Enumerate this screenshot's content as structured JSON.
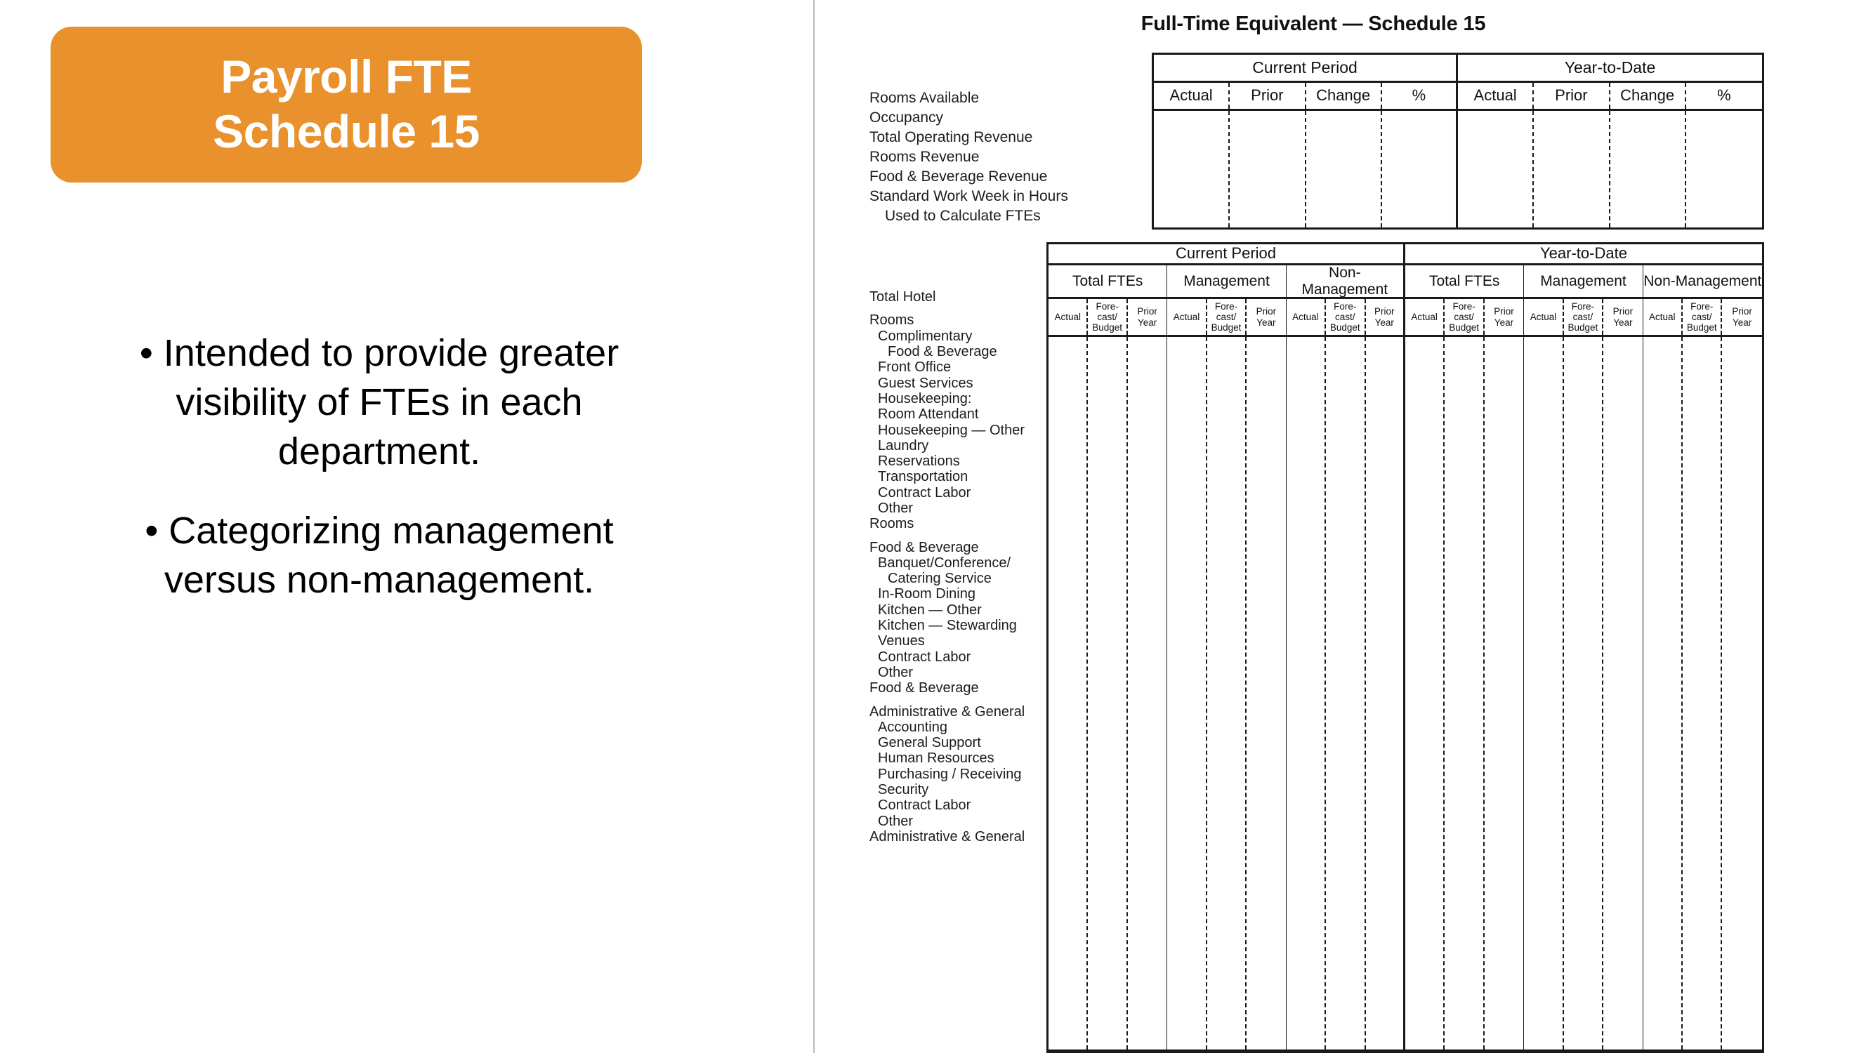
{
  "slide": {
    "title_lines": [
      "Payroll FTE",
      "Schedule 15"
    ],
    "accent_color": "#E8912D",
    "bullets": [
      "Intended to provide greater visibility of FTEs in each department.",
      "Categorizing management versus non-management."
    ],
    "bullet_marker": "•"
  },
  "report": {
    "title": "Full-Time Equivalent — Schedule 15",
    "metrics_table": {
      "row_labels": [
        "Rooms Available",
        "Occupancy",
        "Total Operating Revenue",
        "Rooms Revenue",
        "Food & Beverage Revenue",
        "Standard Work Week in Hours",
        "Used to Calculate FTEs"
      ],
      "period_groups": [
        "Current Period",
        "Year-to-Date"
      ],
      "columns": [
        "Actual",
        "Prior",
        "Change",
        "%"
      ]
    },
    "fte_table": {
      "period_groups": [
        "Current Period",
        "Year-to-Date"
      ],
      "categories": [
        "Total FTEs",
        "Management",
        "Non-Management"
      ],
      "sub_columns": [
        "Actual",
        "Fore-cast/ Budget",
        "Prior Year"
      ],
      "sub_columns_display": [
        [
          "Actual"
        ],
        [
          "Fore-",
          "cast/",
          "Budget"
        ],
        [
          "Prior",
          "Year"
        ]
      ],
      "row_labels": [
        {
          "text": "Total Hotel",
          "level": 0,
          "gap_after": true
        },
        {
          "text": "Rooms",
          "level": 0,
          "gap_after": false
        },
        {
          "text": "Complimentary",
          "level": 1,
          "gap_after": false
        },
        {
          "text": "Food & Beverage",
          "level": 2,
          "gap_after": false
        },
        {
          "text": "Front Office",
          "level": 1,
          "gap_after": false
        },
        {
          "text": "Guest Services",
          "level": 1,
          "gap_after": false
        },
        {
          "text": "Housekeeping:",
          "level": 1,
          "gap_after": false
        },
        {
          "text": "Room Attendant",
          "level": 1,
          "gap_after": false
        },
        {
          "text": "Housekeeping — Other",
          "level": 1,
          "gap_after": false
        },
        {
          "text": "Laundry",
          "level": 1,
          "gap_after": false
        },
        {
          "text": "Reservations",
          "level": 1,
          "gap_after": false
        },
        {
          "text": "Transportation",
          "level": 1,
          "gap_after": false
        },
        {
          "text": "Contract Labor",
          "level": 1,
          "gap_after": false
        },
        {
          "text": "Other",
          "level": 1,
          "gap_after": false
        },
        {
          "text": "Rooms",
          "level": 0,
          "gap_after": true
        },
        {
          "text": "Food & Beverage",
          "level": 0,
          "gap_after": false
        },
        {
          "text": "Banquet/Conference/",
          "level": 1,
          "gap_after": false
        },
        {
          "text": "Catering Service",
          "level": 2,
          "gap_after": false
        },
        {
          "text": "In-Room Dining",
          "level": 1,
          "gap_after": false
        },
        {
          "text": "Kitchen — Other",
          "level": 1,
          "gap_after": false
        },
        {
          "text": "Kitchen — Stewarding",
          "level": 1,
          "gap_after": false
        },
        {
          "text": "Venues",
          "level": 1,
          "gap_after": false
        },
        {
          "text": "Contract Labor",
          "level": 1,
          "gap_after": false
        },
        {
          "text": "Other",
          "level": 1,
          "gap_after": false
        },
        {
          "text": "Food & Beverage",
          "level": 0,
          "gap_after": true
        },
        {
          "text": "Administrative & General",
          "level": 0,
          "gap_after": false
        },
        {
          "text": "Accounting",
          "level": 1,
          "gap_after": false
        },
        {
          "text": "General Support",
          "level": 1,
          "gap_after": false
        },
        {
          "text": "Human Resources",
          "level": 1,
          "gap_after": false
        },
        {
          "text": "Purchasing / Receiving",
          "level": 1,
          "gap_after": false
        },
        {
          "text": "Security",
          "level": 1,
          "gap_after": false
        },
        {
          "text": "Contract Labor",
          "level": 1,
          "gap_after": false
        },
        {
          "text": "Other",
          "level": 1,
          "gap_after": false
        },
        {
          "text": "Administrative & General",
          "level": 0,
          "gap_after": false
        }
      ]
    }
  }
}
